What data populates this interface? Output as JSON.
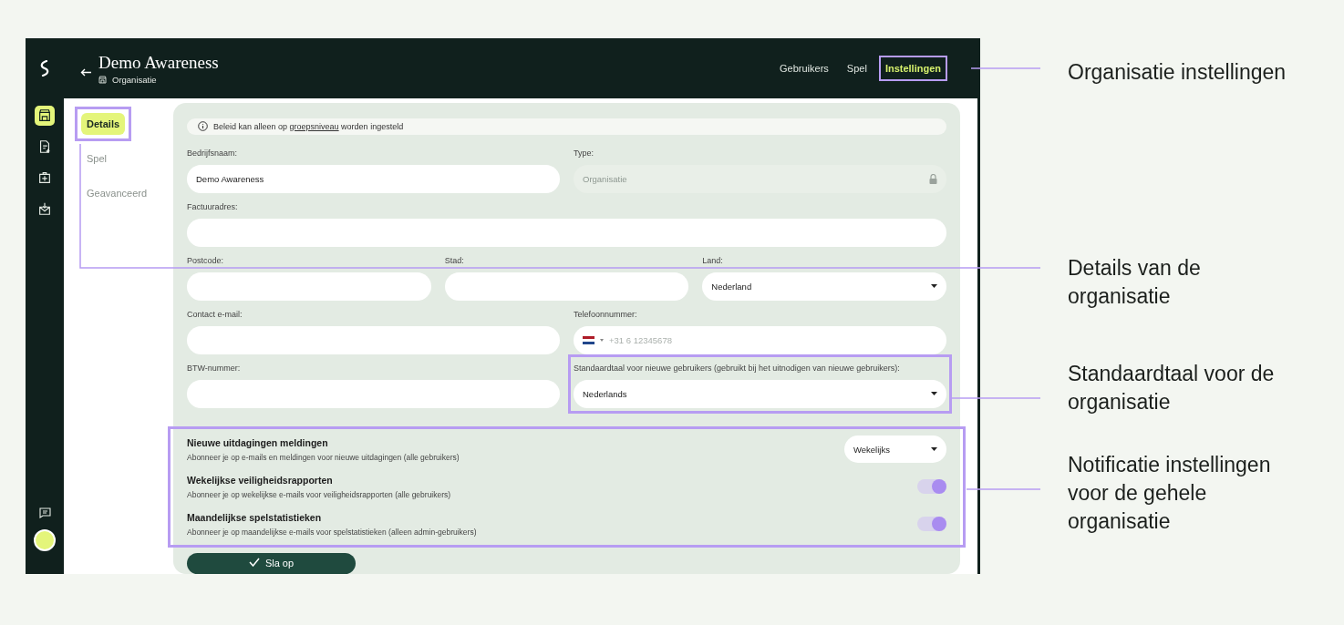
{
  "header": {
    "title": "Demo Awareness",
    "subtitle": "Organisatie"
  },
  "tabs": [
    {
      "label": "Gebruikers",
      "selected": false,
      "highlighted": false
    },
    {
      "label": "Spel",
      "selected": false,
      "highlighted": false
    },
    {
      "label": "Instellingen",
      "selected": true,
      "highlighted": true
    }
  ],
  "rail": {
    "items": [
      {
        "selected": true
      },
      {
        "selected": false
      },
      {
        "selected": false
      },
      {
        "selected": false
      }
    ]
  },
  "subnav": [
    {
      "label": "Details",
      "selected": true,
      "highlighted": true
    },
    {
      "label": "Spel",
      "selected": false,
      "highlighted": false
    },
    {
      "label": "Geavanceerd",
      "selected": false,
      "highlighted": false
    }
  ],
  "info": {
    "before": "Beleid kan alleen op ",
    "link": "groepsniveau",
    "after": " worden ingesteld"
  },
  "form_rows": [
    [
      {
        "kind": "text",
        "label": "Bedrijfsnaam:",
        "value": "Demo Awareness"
      },
      {
        "kind": "locked",
        "label": "Type:",
        "placeholder": "Organisatie"
      }
    ],
    [
      {
        "kind": "text",
        "label": "Factuuradres:"
      }
    ],
    [
      {
        "kind": "text",
        "label": "Postcode:"
      },
      {
        "kind": "text",
        "label": "Stad:"
      },
      {
        "kind": "select",
        "label": "Land:",
        "value": "Nederland"
      }
    ],
    [
      {
        "kind": "text",
        "label": "Contact e-mail:"
      },
      {
        "kind": "phone",
        "label": "Telefoonnummer:",
        "placeholder": "+31 6 12345678"
      }
    ],
    [
      {
        "kind": "text",
        "label": "BTW-nummer:"
      },
      {
        "kind": "select",
        "label": "Standaardtaal voor nieuwe gebruikers (gebruikt bij het uitnodigen van nieuwe gebruikers):",
        "value": "Nederlands",
        "highlighted": true
      }
    ]
  ],
  "notifications": {
    "highlighted": true,
    "items": [
      {
        "kind": "select",
        "title": "Nieuwe uitdagingen meldingen",
        "description": "Abonneer je op e-mails en meldingen voor nieuwe uitdagingen (alle gebruikers)",
        "value": "Wekelijks"
      },
      {
        "kind": "toggle",
        "title": "Wekelijkse veiligheidsrapporten",
        "description": "Abonneer je op wekelijkse e-mails voor veiligheidsrapporten (alle gebruikers)",
        "on": true
      },
      {
        "kind": "toggle",
        "title": "Maandelijkse spelstatistieken",
        "description": "Abonneer je op maandelijkse e-mails voor spelstatistieken (alleen admin-gebruikers)",
        "on": true
      }
    ]
  },
  "save_button": {
    "label": "Sla op"
  },
  "annotations": [
    {
      "text": "Organisatie instellingen"
    },
    {
      "text": "Details van de organisatie"
    },
    {
      "text": "Standaardtaal voor de organisatie"
    },
    {
      "text": "Notificatie instellingen voor de gehele organisatie"
    }
  ]
}
